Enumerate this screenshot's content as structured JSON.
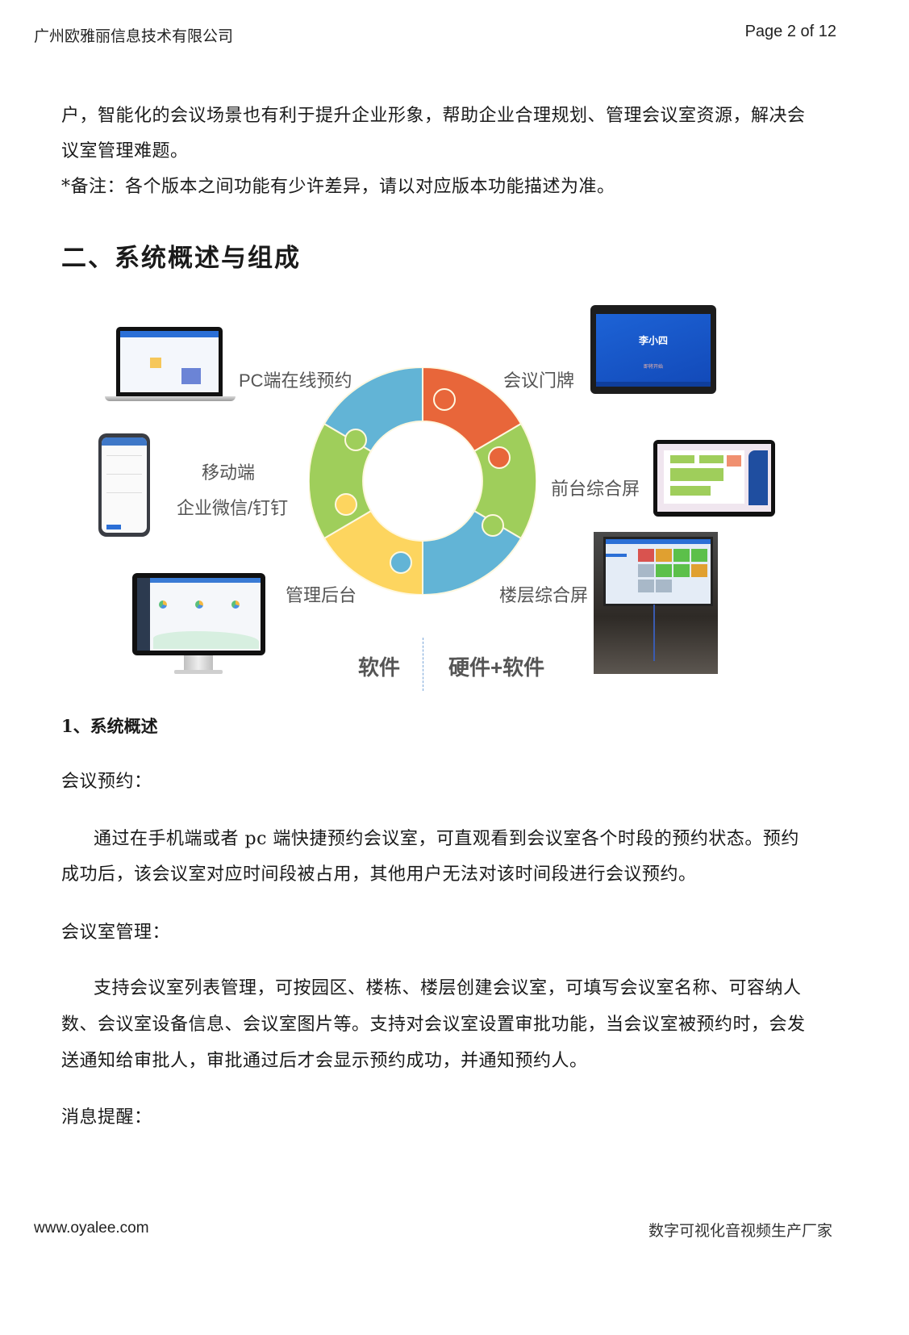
{
  "header": {
    "company": "广州欧雅丽信息技术有限公司",
    "page_indicator": "Page 2 of 12"
  },
  "intro": {
    "lines": [
      "户，智能化的会议场景也有利于提升企业形象，帮助企业合理规划、管理会议室资源，解决会",
      "议室管理难题。",
      "*备注：各个版本之间功能有少许差异，请以对应版本功能描述为准。"
    ]
  },
  "section_title": "二、系统概述与组成",
  "diagram": {
    "labels": {
      "pc": "PC端在线预约",
      "mobile_1": "移动端",
      "mobile_2": "企业微信/钉钉",
      "admin": "管理后台",
      "door_sign": "会议门牌",
      "front_desk": "前台综合屏",
      "floor_screen": "楼层综合屏",
      "software": "软件",
      "hardware_software": "硬件+软件"
    },
    "door_sign_screen": {
      "name": "李小四",
      "button": "即将开始"
    },
    "puzzle_colors": {
      "orange": "#e8663a",
      "green": "#9fce5b",
      "blue": "#62b4d6",
      "yellow": "#fdd55f"
    }
  },
  "subsection_title": "1、系统概述",
  "blocks": [
    {
      "label": "会议预约：",
      "paragraph": [
        "通过在手机端或者 pc 端快捷预约会议室，可直观看到会议室各个时段的预约状态。预约",
        "成功后，该会议室对应时间段被占用，其他用户无法对该时间段进行会议预约。"
      ]
    },
    {
      "label": "会议室管理：",
      "paragraph": [
        "支持会议室列表管理，可按园区、楼栋、楼层创建会议室，可填写会议室名称、可容纳人",
        "数、会议室设备信息、会议室图片等。支持对会议室设置审批功能，当会议室被预约时，会发",
        "送通知给审批人，审批通过后才会显示预约成功，并通知预约人。"
      ]
    },
    {
      "label": "消息提醒：",
      "paragraph": []
    }
  ],
  "footer": {
    "website": "www.oyalee.com",
    "slogan": "数字可视化音视频生产厂家"
  }
}
